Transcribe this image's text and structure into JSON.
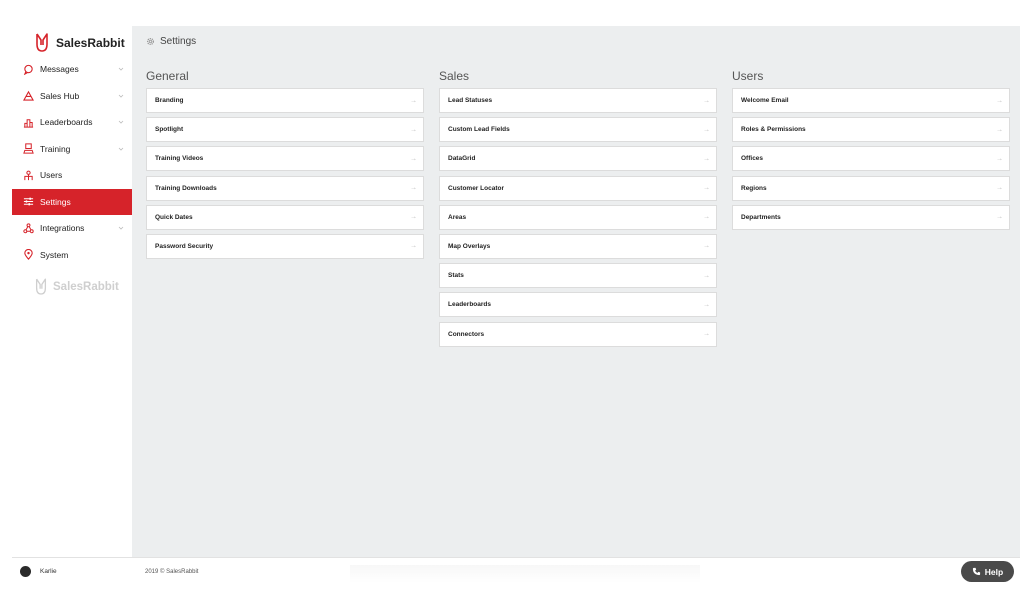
{
  "app": {
    "logo_text": "SalesRabbit",
    "sub_logo_text": "SalesRabbit",
    "accent": "#d6232a"
  },
  "sidebar": {
    "items": [
      {
        "label": "Messages",
        "icon": "chat-icon",
        "has_chevron": true,
        "active": false
      },
      {
        "label": "Sales Hub",
        "icon": "sales-hub-icon",
        "has_chevron": true,
        "active": false
      },
      {
        "label": "Leaderboards",
        "icon": "bar-chart-icon",
        "has_chevron": true,
        "active": false
      },
      {
        "label": "Training",
        "icon": "training-icon",
        "has_chevron": true,
        "active": false
      },
      {
        "label": "Users",
        "icon": "users-icon",
        "has_chevron": false,
        "active": false
      },
      {
        "label": "Settings",
        "icon": "sliders-icon",
        "has_chevron": false,
        "active": true
      },
      {
        "label": "Integrations",
        "icon": "integrations-icon",
        "has_chevron": true,
        "active": false
      },
      {
        "label": "System",
        "icon": "location-pin-icon",
        "has_chevron": false,
        "active": false
      }
    ]
  },
  "header": {
    "title": "Settings",
    "icon": "gear-icon"
  },
  "columns": [
    {
      "title": "General",
      "items": [
        "Branding",
        "Spotlight",
        "Training Videos",
        "Training Downloads",
        "Quick Dates",
        "Password Security"
      ]
    },
    {
      "title": "Sales",
      "items": [
        "Lead Statuses",
        "Custom Lead Fields",
        "DataGrid",
        "Customer Locator",
        "Areas",
        "Map Overlays",
        "Stats",
        "Leaderboards",
        "Connectors"
      ]
    },
    {
      "title": "Users",
      "items": [
        "Welcome Email",
        "Roles & Permissions",
        "Offices",
        "Regions",
        "Departments"
      ]
    }
  ],
  "footer": {
    "user_name": "Karlie",
    "copyright": "2019 © SalesRabbit",
    "help_label": "Help"
  }
}
